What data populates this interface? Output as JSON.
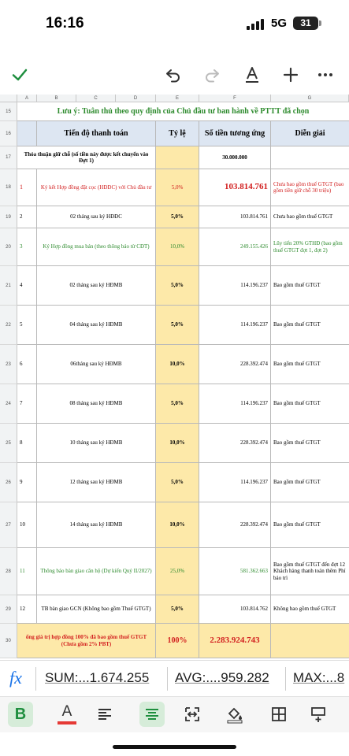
{
  "status": {
    "time": "16:16",
    "network": "5G",
    "battery": "31"
  },
  "toolbar": {
    "confirm_icon": "check-icon",
    "undo_icon": "undo-icon",
    "redo_icon": "redo-icon",
    "text_format_icon": "text-format-icon",
    "add_icon": "plus-icon",
    "more_icon": "more-icon"
  },
  "sheet": {
    "columns": [
      "A",
      "B",
      "C",
      "D",
      "E",
      "F",
      "G"
    ],
    "row_numbers": [
      "15",
      "16",
      "17",
      "18",
      "19",
      "20",
      "21",
      "22",
      "23",
      "24",
      "25",
      "26",
      "27",
      "28",
      "29",
      "30"
    ],
    "note": "Lưu ý: Tuân thủ theo quy định của Chủ đầu tư ban hành về PTTT đã chọn",
    "header": {
      "progress": "Tiến độ thanh toán",
      "ratio": "Tỷ lệ",
      "amount": "Số tiền tương ứng",
      "explanation": "Diễn giải"
    },
    "deposit": {
      "label": "Thỏa thuận giữ chỗ (số tiền này được kết chuyển vào Đợt 1)",
      "amount": "30.000.000"
    },
    "rows": [
      {
        "no": "1",
        "label": "Ký kết Hợp đồng đặt cọc (HĐĐC) với Chủ đầu tư",
        "ratio": "5,0%",
        "amount": "103.814.761",
        "note": "Chưa bao gồm thuế GTGT (bao gồm tiền giữ chỗ 30 triệu)"
      },
      {
        "no": "2",
        "label": "02 tháng sau ký HĐĐC",
        "ratio": "5,0%",
        "amount": "103.814.761",
        "note": "Chưa bao gồm thuế GTGT"
      },
      {
        "no": "3",
        "label": "Ký Hợp đồng mua bán (theo thông báo từ CĐT)",
        "ratio": "10,0%",
        "amount": "249.155.426",
        "note": "Lũy tiến 20% GTHĐ (bao gồm thuế GTGT đợt 1, đợt 2)"
      },
      {
        "no": "4",
        "label": "02 tháng sau ký HĐMB",
        "ratio": "5,0%",
        "amount": "114.196.237",
        "note": "Bao gồm thuế GTGT"
      },
      {
        "no": "5",
        "label": "04 tháng sau ký HĐMB",
        "ratio": "5,0%",
        "amount": "114.196.237",
        "note": "Bao gồm thuế GTGT"
      },
      {
        "no": "6",
        "label": "06tháng sau ký HĐMB",
        "ratio": "10,0%",
        "amount": "228.392.474",
        "note": "Bao gồm thuế GTGT"
      },
      {
        "no": "7",
        "label": "08 tháng sau ký HĐMB",
        "ratio": "5,0%",
        "amount": "114.196.237",
        "note": "Bao gồm thuế GTGT"
      },
      {
        "no": "8",
        "label": "10 tháng sau ký HĐMB",
        "ratio": "10,0%",
        "amount": "228.392.474",
        "note": "Bao gồm thuế GTGT"
      },
      {
        "no": "9",
        "label": "12 tháng sau ký HĐMB",
        "ratio": "5,0%",
        "amount": "114.196.237",
        "note": "Bao gồm thuế GTGT"
      },
      {
        "no": "10",
        "label": "14 tháng sau ký HĐMB",
        "ratio": "10,0%",
        "amount": "228.392.474",
        "note": "Bao gồm thuế GTGT"
      },
      {
        "no": "11",
        "label": "Thông báo bàn giao căn hộ (Dự kiến Quý II/2027)",
        "ratio": "25,0%",
        "amount": "581.362.663",
        "note": "Bao gồm thuế GTGT đến đợt 12 Khách hàng thanh toán thêm Phí bảo trì"
      },
      {
        "no": "12",
        "label": "TB bàn giao GCN (Không bao gồm Thuế GTGT)",
        "ratio": "5,0%",
        "amount": "103.814.762",
        "note": "Không bao gồm thuế GTGT"
      }
    ],
    "total": {
      "label": "ổng giá trị hợp đồng 100% đã bao gồm thuế GTGT (Chưa gồm 2% PBT)",
      "ratio": "100%",
      "amount": "2.283.924.743"
    }
  },
  "stats": {
    "sum": "SUM:...1.674.255",
    "avg": "AVG:....959.282",
    "max": "MAX:...8"
  },
  "format_bar": {
    "bold": "B",
    "text_color": "A",
    "accent": "#1e8e3e",
    "text_color_underline": "#e53935"
  }
}
